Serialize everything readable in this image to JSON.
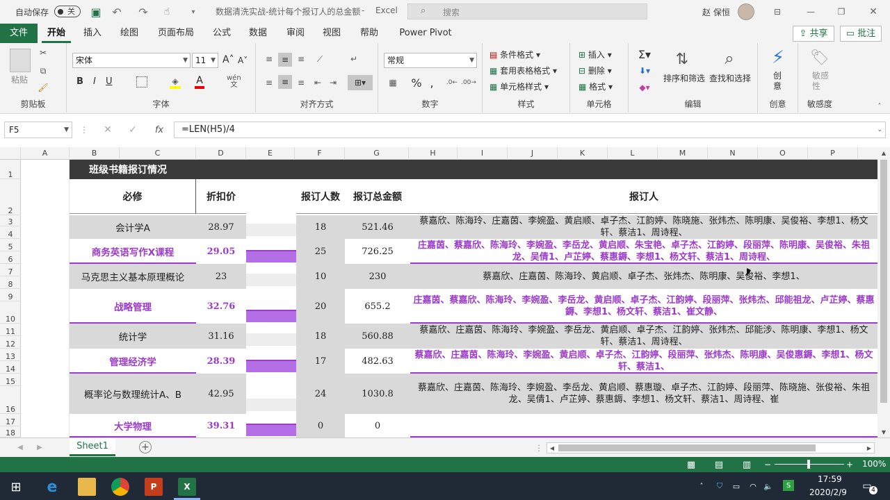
{
  "titlebar": {
    "autosave_label": "自动保存",
    "autosave_state": "关",
    "doc_title": "数据清洗实战-统计每个报订人的总金额",
    "app_name": "Excel",
    "search_placeholder": "搜索",
    "user_name": "赵 保恒"
  },
  "tabs": [
    "文件",
    "开始",
    "插入",
    "绘图",
    "页面布局",
    "公式",
    "数据",
    "审阅",
    "视图",
    "帮助",
    "Power Pivot"
  ],
  "share_label": "共享",
  "comment_label": "批注",
  "ribbon": {
    "clipboard": {
      "paste": "粘贴",
      "label": "剪贴板"
    },
    "font": {
      "name": "宋体",
      "size": "11",
      "bold": "B",
      "italic": "I",
      "underline": "U",
      "label": "字体",
      "wen": "wén"
    },
    "align": {
      "label": "对齐方式"
    },
    "number": {
      "format": "常规",
      "label": "数字"
    },
    "styles": {
      "cond": "条件格式",
      "table": "套用表格格式",
      "cell": "单元格样式",
      "label": "样式"
    },
    "cells": {
      "insert": "插入",
      "delete": "删除",
      "format": "格式",
      "label": "单元格"
    },
    "editing": {
      "sort": "排序和筛选",
      "find": "查找和选择",
      "label": "编辑"
    },
    "creative": {
      "btn": "创意",
      "label": "创意"
    },
    "sensitivity": {
      "btn": "敏感性",
      "label": "敏感度"
    }
  },
  "formula_bar": {
    "name_box": "F5",
    "formula": "=LEN(H5)/4"
  },
  "columns": [
    "A",
    "B",
    "C",
    "D",
    "E",
    "F",
    "G",
    "H",
    "I",
    "J",
    "K",
    "L",
    "M",
    "N",
    "O",
    "P"
  ],
  "rows": [
    "1",
    "2",
    "3",
    "4",
    "5",
    "6",
    "7",
    "8",
    "9",
    "10",
    "11",
    "12",
    "13",
    "14",
    "15",
    "16",
    "17",
    "18"
  ],
  "sheet": {
    "banner": "班级书籍报订情况",
    "headers": {
      "course": "必修",
      "price": "折扣价",
      "count": "报订人数",
      "total": "报订总金额",
      "people": "报订人"
    },
    "records": [
      {
        "course": "会计学A",
        "price": "28.97",
        "count": "18",
        "total": "521.46",
        "people": "蔡嘉欣、陈海玲、庄嘉茵、李婉盈、黄启顺、卓子杰、江韵婷、陈晓施、张炜杰、陈明康、吴俊裕、李想1、杨文轩、蔡洁1、周诗程、",
        "bar": 0.0
      },
      {
        "course": "商务英语写作Ⅹ课程",
        "price": "29.05",
        "count": "25",
        "total": "726.25",
        "people": "庄嘉茵、蔡嘉欣、陈海玲、李婉盈、李岳龙、黄启顺、朱宝艳、卓子杰、江韵婷、段丽萍、陈明康、吴俊裕、朱祖龙、吴倩1、卢芷婷、蔡惠鎒、李想1、杨文轩、蔡洁1、周诗程、",
        "bar": 1.0
      },
      {
        "course": "马克思主义基本原理概论",
        "price": "23",
        "count": "10",
        "total": "230",
        "people": "蔡嘉欣、庄嘉茵、陈海玲、黄启顺、卓子杰、张炜杰、陈明康、吴俊裕、李想1、",
        "bar": 0.0
      },
      {
        "course": "战略管理",
        "price": "32.76",
        "count": "20",
        "total": "655.2",
        "people": "庄嘉茵、蔡嘉欣、陈海玲、李婉盈、李岳龙、黄启顺、卓子杰、江韵婷、段丽萍、张炜杰、邱能祖龙、卢芷婷、蔡惠鎒、李想1、杨文轩、蔡洁1、崔文静、",
        "bar": 1.0
      },
      {
        "course": "统计学",
        "price": "31.16",
        "count": "18",
        "total": "560.88",
        "people": "蔡嘉欣、庄嘉茵、陈海玲、李婉盈、李岳龙、黄启顺、卓子杰、江韵婷、张炜杰、邱能涉、陈明康、李想1、杨文轩、蔡洁1、周诗程、",
        "bar": 0.0
      },
      {
        "course": "管理经济学",
        "price": "28.39",
        "count": "17",
        "total": "482.63",
        "people": "蔡嘉欣、庄嘉茵、陈海玲、李婉盈、黄启顺、卓子杰、江韵婷、段丽萍、张炜杰、陈明康、吴俊惠鎒、李想1、杨文轩、蔡洁1、",
        "bar": 1.0
      },
      {
        "course": "概率论与数理统计A、B",
        "price": "42.95",
        "count": "24",
        "total": "1030.8",
        "people": "蔡嘉欣、庄嘉茵、陈海玲、李婉盈、李岳龙、黄启顺、蔡惠璇、卓子杰、江韵婷、段丽萍、陈晓施、张俊裕、朱祖龙、吴倩1、卢芷婷、蔡惠鎒、李想1、杨文轩、蔡洁1、周诗程、崔",
        "bar": 0.0
      },
      {
        "course": "大学物理",
        "price": "39.31",
        "count": "0",
        "total": "0",
        "people": "",
        "bar": 1.0
      }
    ]
  },
  "sheet_tab": "Sheet1",
  "status": {
    "zoom": "100%"
  },
  "taskbar": {
    "time": "17:59",
    "date": "2020/2/9",
    "notif": "4"
  }
}
